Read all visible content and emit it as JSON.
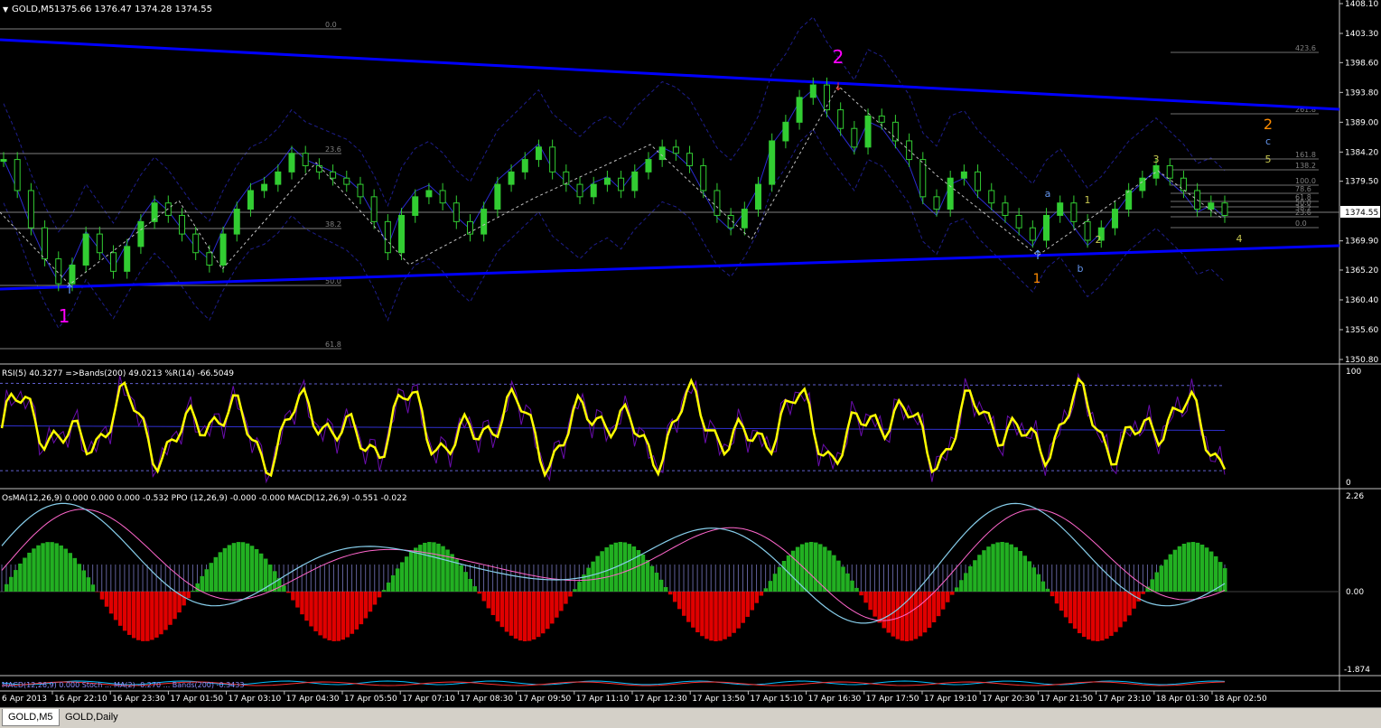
{
  "header": {
    "symbol": "GOLD,M5",
    "ohlc": "1375.66 1376.47 1374.28 1374.55"
  },
  "price_axis": {
    "labels": [
      "1408.10",
      "1403.30",
      "1398.60",
      "1393.80",
      "1389.00",
      "1384.20",
      "1379.50",
      "1374.55",
      "1369.90",
      "1365.20",
      "1360.40",
      "1355.60",
      "1350.80"
    ],
    "current_price": "1374.55"
  },
  "fib_left": [
    "0.0",
    "23.6",
    "38.2",
    "50.0",
    "61.8"
  ],
  "fib_right": [
    "423.6",
    "261.8",
    "161.8",
    "138.2",
    "100.0",
    "78.6",
    "61.8",
    "50.0",
    "38.2",
    "23.6",
    "0.0"
  ],
  "wave_labels": {
    "major_1": "1",
    "major_2": "2",
    "minor": [
      "1",
      "2",
      "3",
      "4",
      "5",
      "1",
      "2",
      "a",
      "b",
      "c"
    ]
  },
  "rsi_panel": {
    "title": "RSI(5) 40.3277  =>Bands(200) 49.0213  %R(14) -66.5049",
    "axis_top": "100",
    "axis_bottom": "0"
  },
  "osma_panel": {
    "title": "OsMA(12,26,9) 0.000 0.000 0.000 -0.532  PPO (12,26,9) -0.000 -0.000  MACD(12,26,9) -0.551 -0.022",
    "axis_top": "2.26",
    "axis_mid": "0.00",
    "axis_bottom": "-1.874"
  },
  "bottom_strip": {
    "title": "MACD(12,26,9) 0.000  Stoch ... MA(2) -0.270  ...  Bands(200) -0.3433"
  },
  "time_axis": [
    "6 Apr 2013",
    "16 Apr 22:10",
    "16 Apr 23:30",
    "17 Apr 01:50",
    "17 Apr 03:10",
    "17 Apr 04:30",
    "17 Apr 05:50",
    "17 Apr 07:10",
    "17 Apr 08:30",
    "17 Apr 09:50",
    "17 Apr 11:10",
    "17 Apr 12:30",
    "17 Apr 13:50",
    "17 Apr 15:10",
    "17 Apr 16:30",
    "17 Apr 17:50",
    "17 Apr 19:10",
    "17 Apr 20:30",
    "17 Apr 21:50",
    "17 Apr 23:10",
    "18 Apr 01:30",
    "18 Apr 02:50"
  ],
  "tabs": [
    "GOLD,M5",
    "GOLD,Daily"
  ],
  "colors": {
    "candle": "#32cd32",
    "trendline": "#0000ff",
    "band": "#1e1e8c",
    "rsi": "#ffff00",
    "wpr": "#6a0dad",
    "wave_major": "#ff00ff",
    "wave_orange": "#ff8c00",
    "wave_yellow": "#9acd32",
    "wave_blue": "#6495ed",
    "hist_green": "#22b022",
    "hist_red": "#e00000",
    "macd_line": "#87ceeb",
    "signal_line": "#ff66cc"
  },
  "chart_data": {
    "type": "line",
    "title": "GOLD,M5",
    "series": [
      {
        "name": "GOLD,M5",
        "values": [
          1383,
          1378,
          1372,
          1367,
          1363,
          1366,
          1371,
          1368,
          1365,
          1369,
          1373,
          1376,
          1374,
          1371,
          1368,
          1366,
          1371,
          1375,
          1378,
          1379,
          1381,
          1384,
          1382,
          1381,
          1380,
          1379,
          1377,
          1373,
          1368,
          1374,
          1377,
          1378,
          1376,
          1373,
          1371,
          1375,
          1379,
          1381,
          1383,
          1385,
          1381,
          1379,
          1377,
          1379,
          1380,
          1378,
          1381,
          1383,
          1385,
          1384,
          1382,
          1378,
          1374,
          1372,
          1375,
          1379,
          1386,
          1389,
          1393,
          1395,
          1391,
          1388,
          1385,
          1390,
          1389,
          1386,
          1383,
          1377,
          1375,
          1380,
          1381,
          1378,
          1376,
          1374,
          1372,
          1370,
          1374,
          1376,
          1373,
          1370,
          1372,
          1375,
          1378,
          1380,
          1382,
          1380,
          1378,
          1375,
          1376,
          1374
        ]
      }
    ],
    "ylim": [
      1350.8,
      1408.1
    ]
  }
}
